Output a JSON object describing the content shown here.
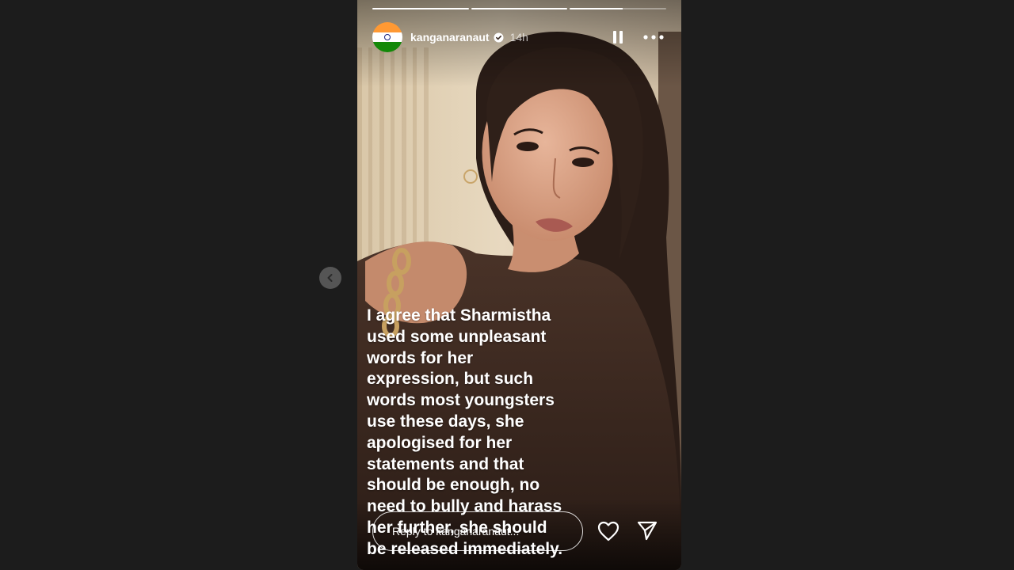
{
  "navigation": {
    "previous_icon": "chevron-left-icon"
  },
  "story": {
    "progress": [
      {
        "fill": 1.0
      },
      {
        "fill": 1.0
      },
      {
        "fill": 0.55
      }
    ],
    "author": {
      "avatar_icon": "indian-flag-avatar",
      "username": "kanganaranaut",
      "verified_icon": "verified-badge-icon",
      "time": "14h"
    },
    "controls": {
      "pause_icon": "pause-icon",
      "more_icon": "more-icon"
    },
    "caption": "I agree that Sharmistha\nused some unpleasant\nwords for her\nexpression, but such\nwords most youngsters\nuse these days, she\napologised for her\nstatements and that\nshould be enough, no\nneed to bully and harass\nher further, she should\nbe released immediately.",
    "reply": {
      "placeholder": "Reply to kanganaranaut..."
    },
    "actions": {
      "like_icon": "heart-icon",
      "share_icon": "send-icon"
    }
  },
  "colors": {
    "background": "#1c1c1c",
    "flag_saffron": "#ff9933",
    "flag_white": "#ffffff",
    "flag_green": "#138808",
    "chakra": "#1a237e"
  }
}
